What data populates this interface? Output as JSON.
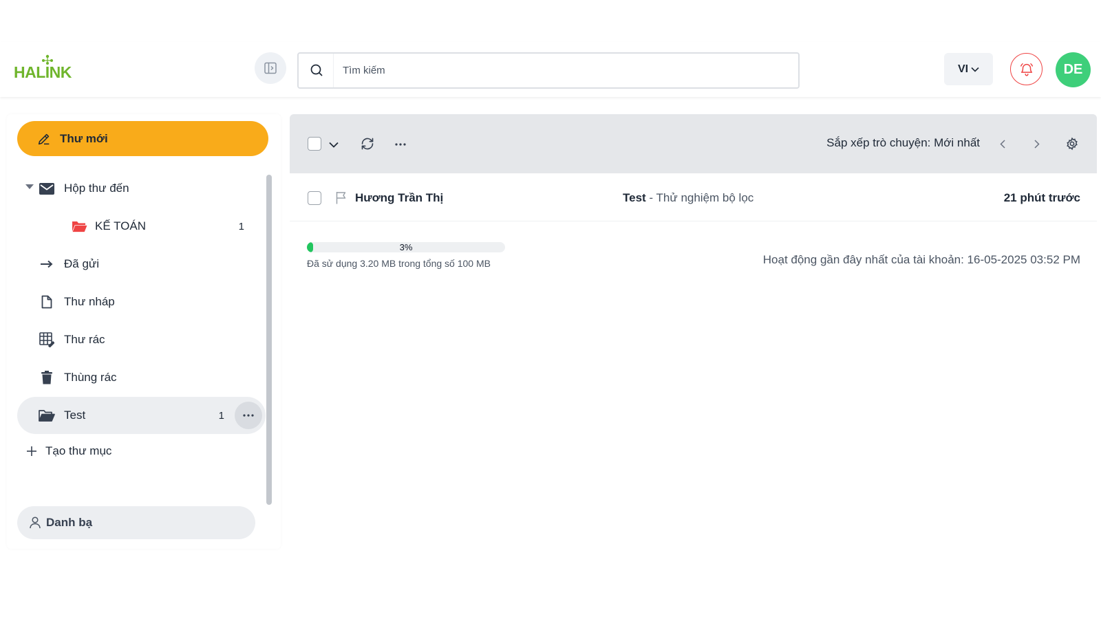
{
  "header": {
    "logo_text": "HALINK",
    "search": {
      "placeholder": "Tìm kiếm",
      "value": ""
    },
    "language": "VI",
    "avatar_initials": "DE"
  },
  "sidebar": {
    "compose_label": "Thư mới",
    "items": [
      {
        "label": "Hộp thư đến",
        "icon": "mail-icon",
        "count": ""
      },
      {
        "label": "KẾ TOÁN",
        "icon": "folder-open-red-icon",
        "count": "1"
      },
      {
        "label": "Đã gửi",
        "icon": "arrow-right-icon",
        "count": ""
      },
      {
        "label": "Thư nháp",
        "icon": "document-icon",
        "count": ""
      },
      {
        "label": "Thư rác",
        "icon": "spam-icon",
        "count": ""
      },
      {
        "label": "Thùng rác",
        "icon": "trash-icon",
        "count": ""
      },
      {
        "label": "Test",
        "icon": "folder-open-icon",
        "count": "1"
      }
    ],
    "new_folder_label": "Tạo thư mục",
    "contacts_label": "Danh bạ"
  },
  "toolbar": {
    "sort_label": "Sắp xếp trò chuyện: Mới nhất"
  },
  "messages": [
    {
      "sender": "Hương Trần Thị",
      "subject": "Test",
      "snippet": " - Thử nghiệm bộ lọc",
      "time": "21 phút trước"
    }
  ],
  "quota": {
    "percent_label": "3%",
    "percent_value": 0.03,
    "used_text": "Đã sử dụng 3.20 MB trong tổng số 100 MB"
  },
  "activity_text": "Hoạt động gần đây nhất của tài khoản: 16-05-2025 03:52 PM",
  "colors": {
    "brand_green": "#6fb52c",
    "compose_orange": "#f9ab1a",
    "avatar_green": "#3ecf7a",
    "bell_red": "#ef4444",
    "folder_red": "#ef4444",
    "quota_green": "#22c55e"
  }
}
